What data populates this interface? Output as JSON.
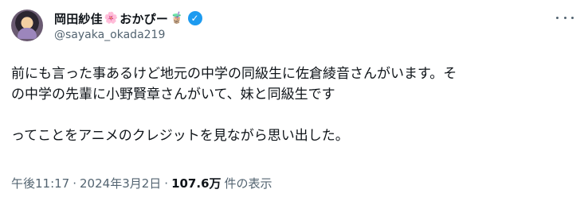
{
  "author": {
    "display_name": "岡田紗佳",
    "display_name_suffix": "おかぴー",
    "handle": "@sayaka_okada219",
    "verified_color": "#1d9bf0",
    "verified_glyph": "✓"
  },
  "emojis": {
    "blossom": "🌸",
    "bubble_tea": "🧋"
  },
  "post": {
    "lines": [
      "前にも言った事あるけど地元の中学の同級生に佐倉綾音さんがいます。そ",
      "の中学の先輩に小野賢章さんがいて、妹と同級生です",
      "",
      "ってことをアニメのクレジットを見ながら思い出した。"
    ]
  },
  "meta": {
    "time": "午後11:17",
    "separator": "·",
    "date": "2024年3月2日",
    "views_count": "107.6万",
    "views_label": "件の表示"
  }
}
